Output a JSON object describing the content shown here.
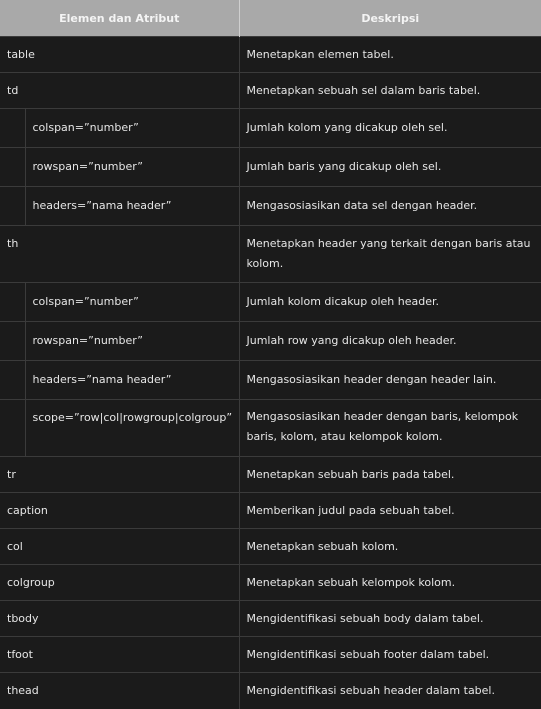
{
  "table": {
    "headers": {
      "element": "Elemen dan Atribut",
      "description": "Deskripsi"
    },
    "rows": [
      {
        "name": "table",
        "desc": "Menetapkan elemen tabel."
      },
      {
        "name": "td",
        "desc": "Menetapkan sebuah sel dalam baris tabel."
      },
      {
        "name": "colspan=”number”",
        "desc": "Jumlah kolom yang dicakup oleh sel."
      },
      {
        "name": "rowspan=”number”",
        "desc": "Jumlah baris yang dicakup oleh sel."
      },
      {
        "name": "headers=”nama header”",
        "desc": "Mengasosiasikan data sel dengan header."
      },
      {
        "name": "th",
        "desc": "Menetapkan header yang terkait dengan baris atau kolom."
      },
      {
        "name": "colspan=”number”",
        "desc": "Jumlah kolom dicakup oleh header."
      },
      {
        "name": "rowspan=”number”",
        "desc": "Jumlah row yang dicakup oleh header."
      },
      {
        "name": "headers=”nama header”",
        "desc": "Mengasosiasikan header dengan header lain."
      },
      {
        "name": "scope=”row|col|rowgroup|colgroup”",
        "desc": "Mengasosiasikan header dengan baris, kelompok baris, kolom, atau kelompok kolom."
      },
      {
        "name": "tr",
        "desc": "Menetapkan sebuah baris pada tabel."
      },
      {
        "name": "caption",
        "desc": "Memberikan judul pada sebuah tabel."
      },
      {
        "name": "col",
        "desc": "Menetapkan sebuah kolom."
      },
      {
        "name": "colgroup",
        "desc": "Menetapkan sebuah kelompok kolom."
      },
      {
        "name": "tbody",
        "desc": "Mengidentifikasi sebuah body dalam tabel."
      },
      {
        "name": "tfoot",
        "desc": "Mengidentifikasi sebuah footer dalam tabel."
      },
      {
        "name": "thead",
        "desc": "Mengidentifikasi sebuah header dalam tabel."
      }
    ]
  }
}
